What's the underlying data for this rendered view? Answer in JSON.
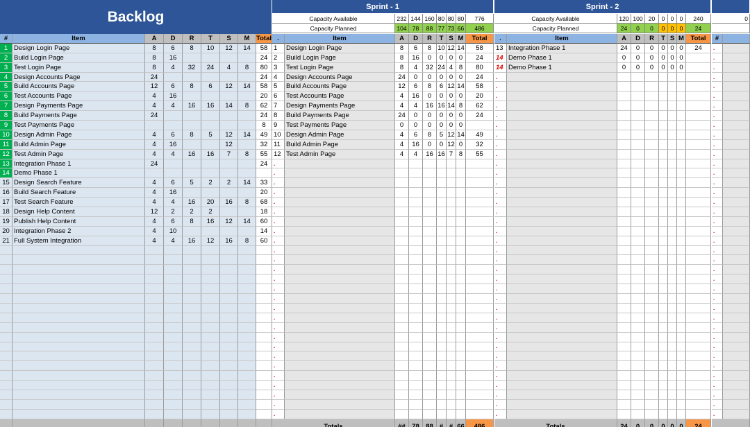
{
  "backlog": {
    "title": "Backlog",
    "headers": [
      "#",
      "Item",
      "A",
      "D",
      "R",
      "T",
      "S",
      "M",
      "Total"
    ],
    "rows": [
      [
        "1",
        "Design Login Page",
        "8",
        "6",
        "8",
        "10",
        "12",
        "14",
        "58"
      ],
      [
        "2",
        "Build Login Page",
        "8",
        "16",
        "",
        "",
        "",
        "",
        "24"
      ],
      [
        "3",
        "Test Login Page",
        "8",
        "4",
        "32",
        "24",
        "4",
        "8",
        "80"
      ],
      [
        "4",
        "Design Accounts Page",
        "24",
        "",
        "",
        "",
        "",
        "",
        "24"
      ],
      [
        "5",
        "Build Accounts Page",
        "12",
        "6",
        "8",
        "6",
        "12",
        "14",
        "58"
      ],
      [
        "6",
        "Test Accounts Page",
        "4",
        "16",
        "",
        "",
        "",
        "",
        "20"
      ],
      [
        "7",
        "Design Payments Page",
        "4",
        "4",
        "16",
        "16",
        "14",
        "8",
        "62"
      ],
      [
        "8",
        "Build Payments Page",
        "24",
        "",
        "",
        "",
        "",
        "",
        "24"
      ],
      [
        "9",
        "Test Payments Page",
        "",
        "",
        "",
        "",
        "",
        "",
        "8"
      ],
      [
        "10",
        "Design Admin Page",
        "4",
        "6",
        "8",
        "5",
        "12",
        "14",
        "49"
      ],
      [
        "11",
        "Build Admin Page",
        "4",
        "16",
        "",
        "",
        "12",
        "",
        "32"
      ],
      [
        "12",
        "Test Admin Page",
        "4",
        "4",
        "16",
        "16",
        "7",
        "8",
        "55"
      ],
      [
        "13",
        "Integration Phase 1",
        "24",
        "",
        "",
        "",
        "",
        "",
        "24"
      ],
      [
        "14",
        "Demo Phase 1",
        "",
        "",
        "",
        "",
        "",
        "",
        ""
      ],
      [
        "15",
        "Design Search Feature",
        "4",
        "6",
        "5",
        "2",
        "2",
        "14",
        "33"
      ],
      [
        "16",
        "Build Search Feature",
        "4",
        "16",
        "",
        "",
        "",
        "",
        "20"
      ],
      [
        "17",
        "Test Search Feature",
        "4",
        "4",
        "16",
        "20",
        "16",
        "8",
        "68"
      ],
      [
        "18",
        "Design Help Content",
        "12",
        "2",
        "2",
        "2",
        "",
        "",
        "18"
      ],
      [
        "19",
        "Publish Help Content",
        "4",
        "6",
        "8",
        "16",
        "12",
        "14",
        "60"
      ],
      [
        "20",
        "Integration Phase 2",
        "4",
        "10",
        "",
        "",
        "",
        "",
        "14"
      ],
      [
        "21",
        "Full System Integration",
        "4",
        "4",
        "16",
        "12",
        "16",
        "8",
        "60"
      ]
    ]
  },
  "sprint1": {
    "title": "Sprint - 1",
    "capacity_available_label": "Capacity Available",
    "capacity_planned_label": "Capacity Planned",
    "capacity_available": [
      "232",
      "144",
      "160",
      "80",
      "80",
      "80",
      "776"
    ],
    "capacity_planned": [
      "104",
      "78",
      "88",
      "77",
      "73",
      "66",
      "486"
    ],
    "headers": [
      ".",
      "Item",
      "A",
      "D",
      "R",
      "T",
      "S",
      "M",
      "Total"
    ],
    "rows": [
      [
        "1",
        "Design Login Page",
        "8",
        "6",
        "8",
        "10",
        "12",
        "14",
        "58"
      ],
      [
        "2",
        "Build Login Page",
        "8",
        "16",
        "0",
        "0",
        "0",
        "0",
        "24"
      ],
      [
        "3",
        "Test Login Page",
        "8",
        "4",
        "32",
        "24",
        "4",
        "8",
        "80"
      ],
      [
        "4",
        "Design Accounts Page",
        "24",
        "0",
        "0",
        "0",
        "0",
        "0",
        "24"
      ],
      [
        "5",
        "Build Accounts Page",
        "12",
        "6",
        "8",
        "6",
        "12",
        "14",
        "58"
      ],
      [
        "6",
        "Test Accounts Page",
        "4",
        "16",
        "0",
        "0",
        "0",
        "0",
        "20"
      ],
      [
        "7",
        "Design Payments Page",
        "4",
        "4",
        "16",
        "16",
        "14",
        "8",
        "62"
      ],
      [
        "8",
        "Build Payments Page",
        "24",
        "0",
        "0",
        "0",
        "0",
        "0",
        "24"
      ],
      [
        "9",
        "Test Payments Page",
        "0",
        "0",
        "0",
        "0",
        "0",
        "0",
        ""
      ],
      [
        "10",
        "Design Admin Page",
        "4",
        "6",
        "8",
        "5",
        "12",
        "14",
        "49"
      ],
      [
        "11",
        "Build Admin Page",
        "4",
        "16",
        "0",
        "0",
        "12",
        "0",
        "32"
      ],
      [
        "12",
        "Test Admin Page",
        "4",
        "4",
        "16",
        "16",
        "7",
        "8",
        "55"
      ]
    ],
    "totals_label": "Totals",
    "totals": [
      "##",
      "78",
      "88",
      "#",
      "#",
      "66",
      "486"
    ]
  },
  "sprint2": {
    "title": "Sprint - 2",
    "capacity_available_label": "Capacity Available",
    "capacity_planned_label": "Capacity Planned",
    "capacity_available": [
      "120",
      "100",
      "20",
      "0",
      "0",
      "0",
      "240"
    ],
    "capacity_planned": [
      "24",
      "0",
      "0",
      "0",
      "0",
      "0",
      "24"
    ],
    "headers": [
      ".",
      "Item",
      "A",
      "D",
      "R",
      "T",
      "S",
      "M",
      "Total"
    ],
    "rows": [
      [
        "13",
        "Integration Phase 1",
        "24",
        "0",
        "0",
        "0",
        "0",
        "0",
        "24"
      ],
      [
        "14",
        "Demo Phase 1",
        "0",
        "0",
        "0",
        "0",
        "0",
        "0",
        ""
      ],
      [
        "14",
        "Demo Phase 1",
        "0",
        "0",
        "0",
        "0",
        "0",
        "0",
        ""
      ]
    ],
    "totals_label": "Totals",
    "totals": [
      "24",
      "0",
      "0",
      "0",
      "0",
      "0",
      "24"
    ]
  },
  "sprint3": {
    "capacity_available": [
      "0"
    ],
    "header": "#"
  },
  "dot": "."
}
